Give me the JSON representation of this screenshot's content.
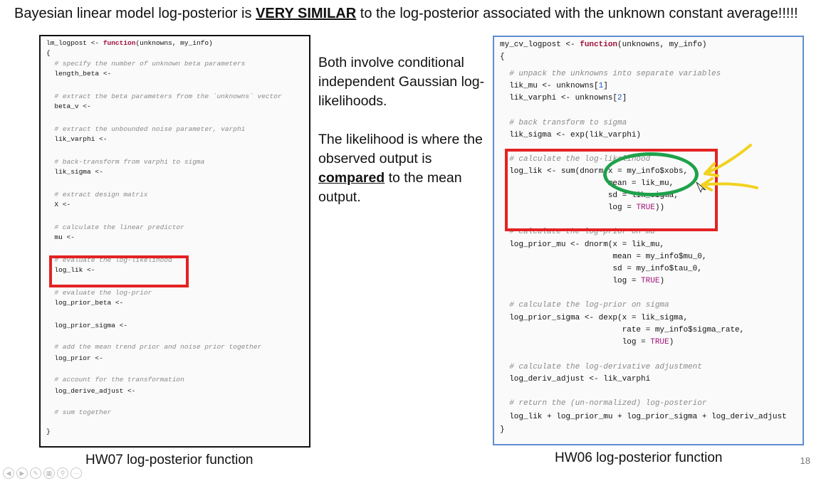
{
  "slide": {
    "title_part1": "Bayesian linear model log-posterior is ",
    "title_highlight": "VERY SIMILAR",
    "title_part2": " to the log-posterior associated with the unknown constant average!!!!!",
    "middle": {
      "para1": "Both involve conditional independent Gaussian log-likelihoods.",
      "para2_a": "The likelihood is where the observed output is ",
      "para2_b": "compared",
      "para2_c": " to the mean output."
    },
    "caption_left": "HW07 log-posterior function",
    "caption_right": "HW06 log-posterior function",
    "slide_number": "18",
    "nav_icons": [
      "back-icon",
      "forward-icon",
      "pen-icon",
      "slides-icon",
      "zoom-icon",
      "more-icon"
    ],
    "colors": {
      "highlight_red": "#e32222",
      "circle_green": "#1fa14a",
      "annotation_yellow": "#f2d21e",
      "panel_border_blue": "#5b8fd0"
    }
  },
  "left_code": [
    "lm_logpost <- function(unknowns, my_info)",
    "{",
    "  # specify the number of unknown beta parameters",
    "  length_beta <-",
    "  # extract the beta parameters from the `unknowns` vector",
    "  beta_v <-",
    "  # extract the unbounded noise parameter, varphi",
    "  lik_varphi <-",
    "  # back-transform from varphi to sigma",
    "  lik_sigma <-",
    "  # extract design matrix",
    "  X <-",
    "  # calculate the linear predictor",
    "  mu <-",
    "  # evaluate the log-likelihood",
    "  log_lik <-",
    "  # evaluate the log-prior",
    "  log_prior_beta <-",
    "  log_prior_sigma <-",
    "  # add the mean trend prior and noise prior together",
    "  log_prior <-",
    "  # account for the transformation",
    "  log_derive_adjust <-",
    "  # sum together",
    "}"
  ],
  "right_code": [
    "my_cv_logpost <- function(unknowns, my_info)",
    "{",
    "  # unpack the unknowns into separate variables",
    "  lik_mu <- unknowns[1]",
    "  lik_varphi <- unknowns[2]",
    "  # back transform to sigma",
    "  lik_sigma <- exp(lik_varphi)",
    "  # calculate the log-likelihood",
    "  log_lik <- sum(dnorm(x = my_info$xobs,",
    "                       mean = lik_mu,",
    "                       sd = lik_sigma,",
    "                       log = TRUE))",
    "  # calculate the log-prior on mu",
    "  log_prior_mu <- dnorm(x = lik_mu,",
    "                        mean = my_info$mu_0,",
    "                        sd = my_info$tau_0,",
    "                        log = TRUE)",
    "  # calculate the log-prior on sigma",
    "  log_prior_sigma <- dexp(x = lik_sigma,",
    "                          rate = my_info$sigma_rate,",
    "                          log = TRUE)",
    "  # calculate the log-derivative adjustment",
    "  log_deriv_adjust <- lik_varphi",
    "  # return the (un-normalized) log-posterior",
    "  log_lik + log_prior_mu + log_prior_sigma + log_deriv_adjust",
    "}"
  ]
}
